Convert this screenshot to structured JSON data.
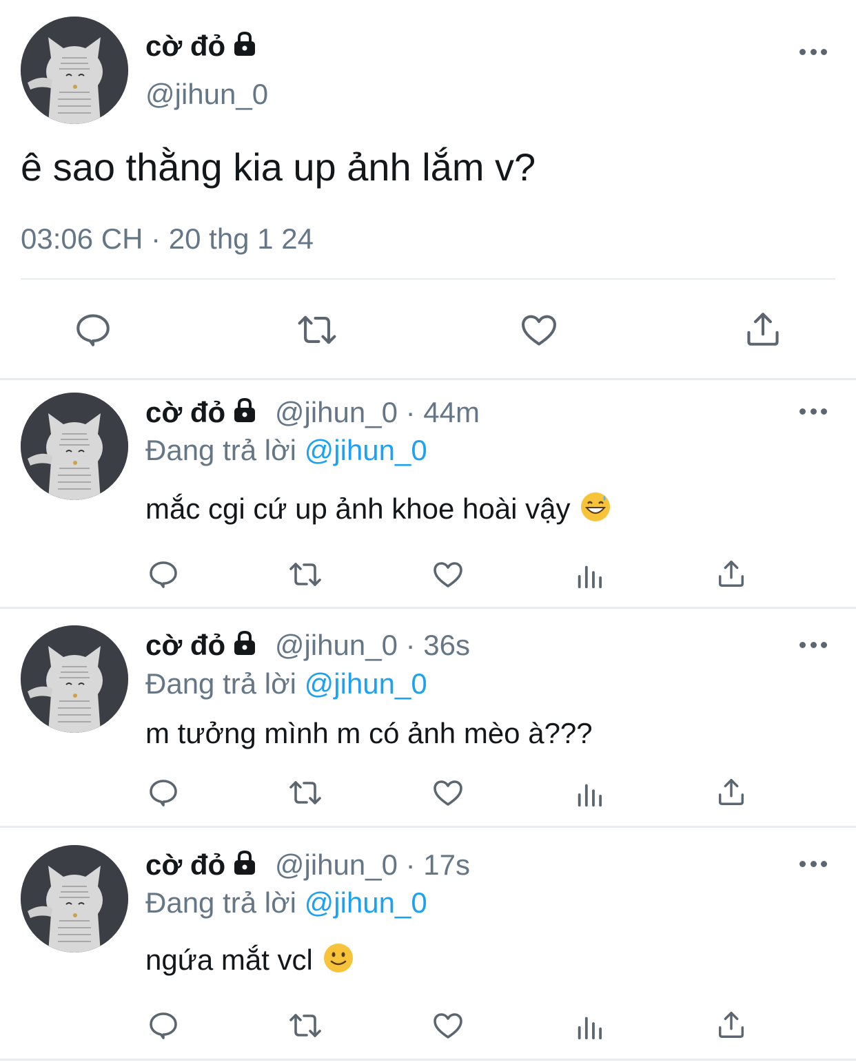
{
  "main_tweet": {
    "display_name": "cờ đỏ",
    "handle": "@jihun_0",
    "text": "ê sao thằng kia up ảnh lắm v?",
    "timestamp": "03:06 CH · 20 thg 1 24"
  },
  "replies": [
    {
      "display_name": "cờ đỏ",
      "handle": "@jihun_0",
      "time": "· 44m",
      "replying_prefix": "Đang trả lời",
      "replying_to": "@jihun_0",
      "text": "mắc cgi cứ up ảnh khoe hoài vậy"
    },
    {
      "display_name": "cờ đỏ",
      "handle": "@jihun_0",
      "time": "· 36s",
      "replying_prefix": "Đang trả lời",
      "replying_to": "@jihun_0",
      "text": "m tưởng mình m có ảnh mèo à???"
    },
    {
      "display_name": "cờ đỏ",
      "handle": "@jihun_0",
      "time": "· 17s",
      "replying_prefix": "Đang trả lời",
      "replying_to": "@jihun_0",
      "text": "ngứa mắt vcl"
    }
  ],
  "icons": [
    "lock-icon",
    "more-icon",
    "reply-icon",
    "retweet-icon",
    "like-icon",
    "analytics-icon",
    "share-icon",
    "grinning-sweat-emoji",
    "slightly-smiling-emoji"
  ],
  "colors": {
    "link": "#1da1f2",
    "secondary_text": "#657786",
    "icon": "#5b6670",
    "divider": "#e6ecf0"
  }
}
